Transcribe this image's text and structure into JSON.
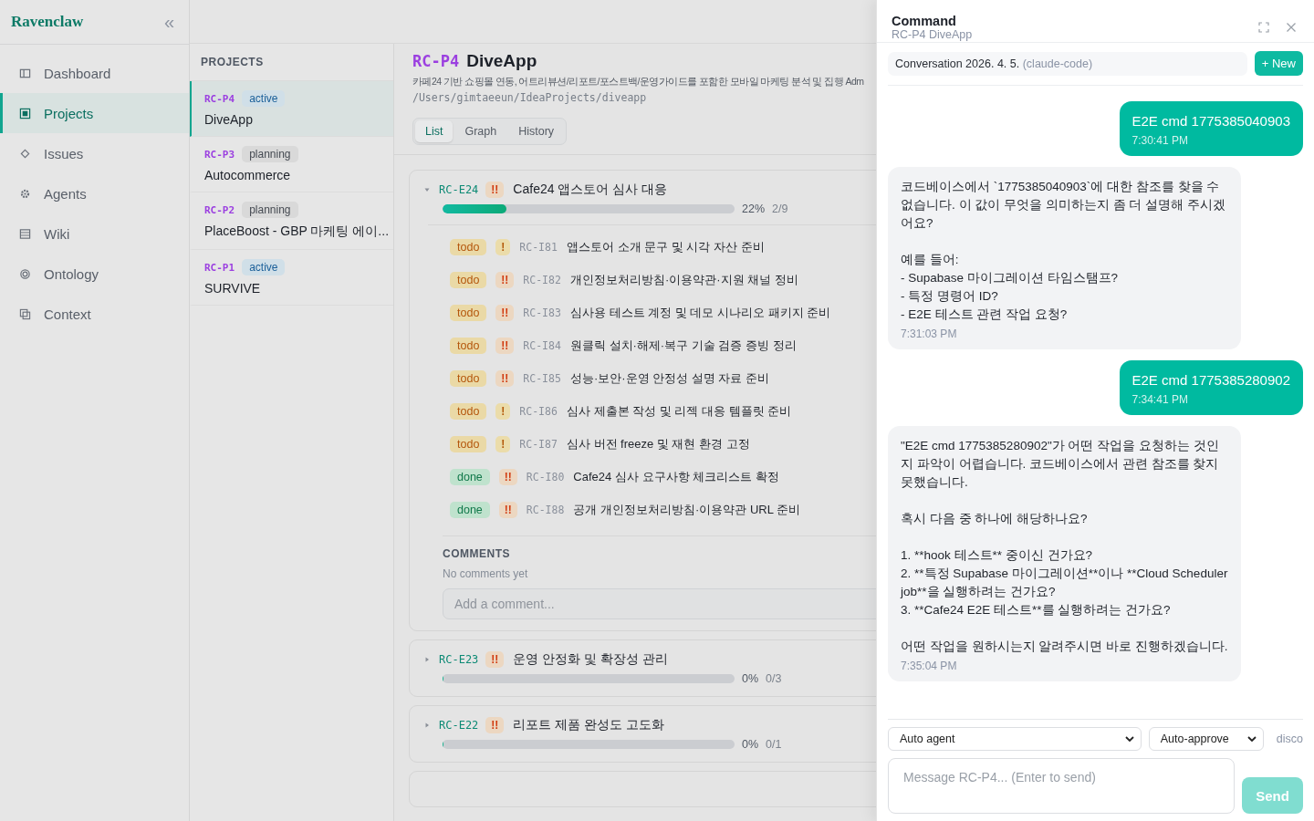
{
  "sidebar": {
    "brand": "Ravenclaw",
    "collapse": "«",
    "items": [
      {
        "label": "Dashboard",
        "selected": false
      },
      {
        "label": "Projects",
        "selected": true
      },
      {
        "label": "Issues",
        "selected": false
      },
      {
        "label": "Agents",
        "selected": false
      },
      {
        "label": "Wiki",
        "selected": false
      },
      {
        "label": "Ontology",
        "selected": false
      },
      {
        "label": "Context",
        "selected": false
      }
    ]
  },
  "projects": {
    "heading": "PROJECTS",
    "items": [
      {
        "key": "RC-P4",
        "status": "active",
        "kind": "active",
        "name": "DiveApp",
        "selected": true
      },
      {
        "key": "RC-P3",
        "status": "planning",
        "kind": "planning",
        "name": "Autocommerce",
        "selected": false
      },
      {
        "key": "RC-P2",
        "status": "planning",
        "kind": "planning",
        "name": "PlaceBoost - GBP 마케팅 에이...",
        "selected": false
      },
      {
        "key": "RC-P1",
        "status": "active",
        "kind": "active",
        "name": "SURVIVE",
        "selected": false
      }
    ]
  },
  "project": {
    "key": "RC-P4",
    "name": "DiveApp",
    "description": "카페24 기반 쇼핑몰 연동, 어트리뷰션/리포트/포스트백/운영가이드를 포함한 모바일 마케팅 분석 및 집행 Adm",
    "path": "/Users/gimtaeeun/IdeaProjects/diveapp",
    "tabs": [
      {
        "label": "List",
        "selected": true
      },
      {
        "label": "Graph",
        "selected": false
      },
      {
        "label": "History",
        "selected": false
      }
    ],
    "epics": [
      {
        "key": "RC-E24",
        "priority": "!!",
        "high": true,
        "title": "Cafe24 앱스토어 심사 대응",
        "expanded": true,
        "level": 0.22,
        "percent": "22%",
        "count": "2/9",
        "tasks": [
          {
            "status": "todo",
            "kind": "todo",
            "priority": "!",
            "high": false,
            "key": "RC-I81",
            "title": "앱스토어 소개 문구 및 시각 자산 준비"
          },
          {
            "status": "todo",
            "kind": "todo",
            "priority": "!!",
            "high": true,
            "key": "RC-I82",
            "title": "개인정보처리방침·이용약관·지원 채널 정비"
          },
          {
            "status": "todo",
            "kind": "todo",
            "priority": "!!",
            "high": true,
            "key": "RC-I83",
            "title": "심사용 테스트 계정 및 데모 시나리오 패키지 준비"
          },
          {
            "status": "todo",
            "kind": "todo",
            "priority": "!!",
            "high": true,
            "key": "RC-I84",
            "title": "원클릭 설치·해제·복구 기술 검증 증빙 정리"
          },
          {
            "status": "todo",
            "kind": "todo",
            "priority": "!!",
            "high": true,
            "key": "RC-I85",
            "title": "성능·보안·운영 안정성 설명 자료 준비"
          },
          {
            "status": "todo",
            "kind": "todo",
            "priority": "!",
            "high": false,
            "key": "RC-I86",
            "title": "심사 제출본 작성 및 리젝 대응 템플릿 준비"
          },
          {
            "status": "todo",
            "kind": "todo",
            "priority": "!",
            "high": false,
            "key": "RC-I87",
            "title": "심사 버전 freeze 및 재현 환경 고정"
          },
          {
            "status": "done",
            "kind": "done",
            "priority": "!!",
            "high": true,
            "key": "RC-I80",
            "title": "Cafe24 심사 요구사항 체크리스트 확정"
          },
          {
            "status": "done",
            "kind": "done",
            "priority": "!!",
            "high": true,
            "key": "RC-I88",
            "title": "공개 개인정보처리방침·이용약관 URL 준비"
          }
        ],
        "comments": {
          "heading": "COMMENTS",
          "empty": "No comments yet",
          "placeholder": "Add a comment..."
        }
      },
      {
        "key": "RC-E23",
        "priority": "!!",
        "high": true,
        "title": "운영 안정화 및 확장성 관리",
        "expanded": false,
        "level": 0,
        "percent": "0%",
        "count": "0/3"
      },
      {
        "key": "RC-E22",
        "priority": "!!",
        "high": true,
        "title": "리포트 제품 완성도 고도화",
        "expanded": false,
        "level": 0,
        "percent": "0%",
        "count": "0/1"
      }
    ]
  },
  "command": {
    "title": "Command",
    "subtitle": "RC-P4 DiveApp",
    "conversation": "Conversation 2026. 4. 5.",
    "agent": "(claude-code)",
    "new_button": "+ New",
    "messages": [
      {
        "kind": "user",
        "text": "E2E cmd 1775385040903",
        "time": "7:30:41 PM"
      },
      {
        "kind": "assistant",
        "text": "코드베이스에서 `1775385040903`에 대한 참조를 찾을 수 없습니다. 이 값이 무엇을 의미하는지 좀 더 설명해 주시겠어요?\n\n예를 들어:\n- Supabase 마이그레이션 타임스탬프?\n- 특정 명령어 ID?\n- E2E 테스트 관련 작업 요청?",
        "time": "7:31:03 PM"
      },
      {
        "kind": "user",
        "text": "E2E cmd 1775385280902",
        "time": "7:34:41 PM"
      },
      {
        "kind": "assistant",
        "text": "\"E2E cmd 1775385280902\"가 어떤 작업을 요청하는 것인지 파악이 어렵습니다. 코드베이스에서 관련 참조를 찾지 못했습니다.\n\n혹시 다음 중 하나에 해당하나요?\n\n1. **hook 테스트** 중이신 건가요?\n2. **특정 Supabase 마이그레이션**이나 **Cloud Scheduler job**을 실행하려는 건가요?\n3. **Cafe24 E2E 테스트**를 실행하려는 건가요?\n\n어떤 작업을 원하시는지 알려주시면 바로 진행하겠습니다.",
        "time": "7:35:04 PM"
      }
    ],
    "agent_select": "Auto agent",
    "approve_select": "Auto-approve",
    "disconnect": "disco",
    "placeholder": "Message RC-P4... (Enter to send)",
    "send": {
      "label": "Send",
      "disabled": true
    }
  }
}
